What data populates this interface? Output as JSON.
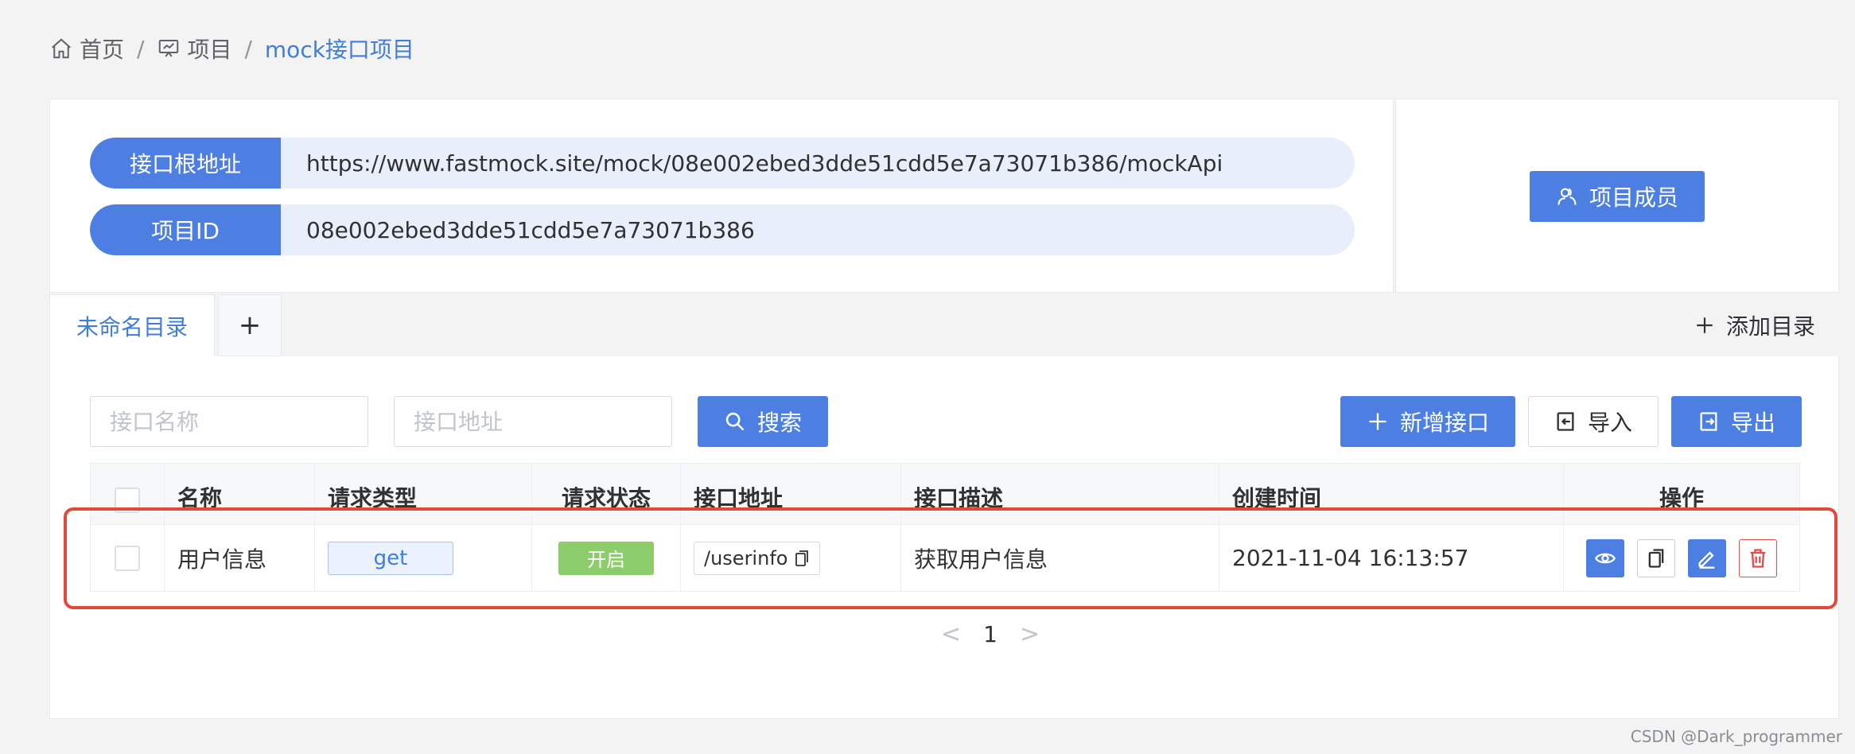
{
  "breadcrumb": {
    "home": "首页",
    "project": "项目",
    "current": "mock接口项目",
    "separator": "/"
  },
  "info": {
    "root_label": "接口根地址",
    "root_url": "https://www.fastmock.site/mock/08e002ebed3dde51cdd5e7a73071b386/mockApi",
    "id_label": "项目ID",
    "id_value": "08e002ebed3dde51cdd5e7a73071b386"
  },
  "members_button": "项目成员",
  "tabs": {
    "active": "未命名目录",
    "add": "+",
    "add_dir": "添加目录"
  },
  "search": {
    "name_placeholder": "接口名称",
    "addr_placeholder": "接口地址",
    "search_button": "搜索"
  },
  "actions": {
    "add": "新增接口",
    "import": "导入",
    "export": "导出"
  },
  "table": {
    "headers": {
      "name": "名称",
      "type": "请求类型",
      "status": "请求状态",
      "addr": "接口地址",
      "desc": "接口描述",
      "time": "创建时间",
      "ops": "操作"
    },
    "rows": [
      {
        "name": "用户信息",
        "type": "get",
        "status": "开启",
        "addr": "/userinfo",
        "desc": "获取用户信息",
        "time": "2021-11-04 16:13:57"
      }
    ]
  },
  "pagination": {
    "prev": "<",
    "current": "1",
    "next": ">"
  },
  "watermark": "CSDN @Dark_programmer",
  "colors": {
    "primary": "#4d7fe3",
    "highlight": "#e14a3a",
    "status_on": "#8dcc6b",
    "danger": "#e54b4b"
  }
}
